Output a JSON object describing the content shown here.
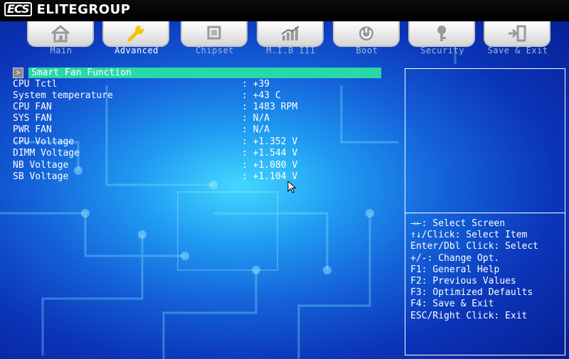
{
  "brand": {
    "logo_mark": "ECS",
    "name": "ELITEGROUP"
  },
  "tabs": [
    {
      "label": "Main",
      "icon": "home-icon",
      "active": false
    },
    {
      "label": "Advanced",
      "icon": "wrench-icon",
      "active": true
    },
    {
      "label": "Chipset",
      "icon": "chip-icon",
      "active": false
    },
    {
      "label": "M.I.B III",
      "icon": "bar-graph-icon",
      "active": false
    },
    {
      "label": "Boot",
      "icon": "power-icon",
      "active": false
    },
    {
      "label": "Security",
      "icon": "key-icon",
      "active": false
    },
    {
      "label": "Save & Exit",
      "icon": "exit-door-icon",
      "active": false
    }
  ],
  "section": {
    "arrow": ">",
    "title": "Smart Fan Function"
  },
  "readings": [
    {
      "label": "CPU Tctl",
      "value": ": +39"
    },
    {
      "label": "System temperature",
      "value": ": +43 C"
    },
    {
      "label": "CPU FAN",
      "value": ": 1483 RPM"
    },
    {
      "label": "SYS FAN",
      "value": ": N/A"
    },
    {
      "label": "PWR FAN",
      "value": ": N/A"
    },
    {
      "label": "CPU Voltage",
      "value": ": +1.352 V"
    },
    {
      "label": "DIMM Voltage",
      "value": ": +1.544 V"
    },
    {
      "label": "NB Voltage",
      "value": ": +1.080 V"
    },
    {
      "label": "SB Voltage",
      "value": ": +1.104 V"
    }
  ],
  "help": [
    "→←: Select Screen",
    "↑↓/Click: Select Item",
    "Enter/Dbl Click: Select",
    "+/-: Change Opt.",
    "F1: General Help",
    "F2: Previous Values",
    "F3: Optimized Defaults",
    "F4: Save & Exit",
    "ESC/Right Click: Exit"
  ],
  "colors": {
    "accent_highlight": "#29d8a8",
    "active_tab_icon": "#f2c400",
    "background_deep": "#0d2fb0",
    "background_glow": "#43d8ff"
  }
}
